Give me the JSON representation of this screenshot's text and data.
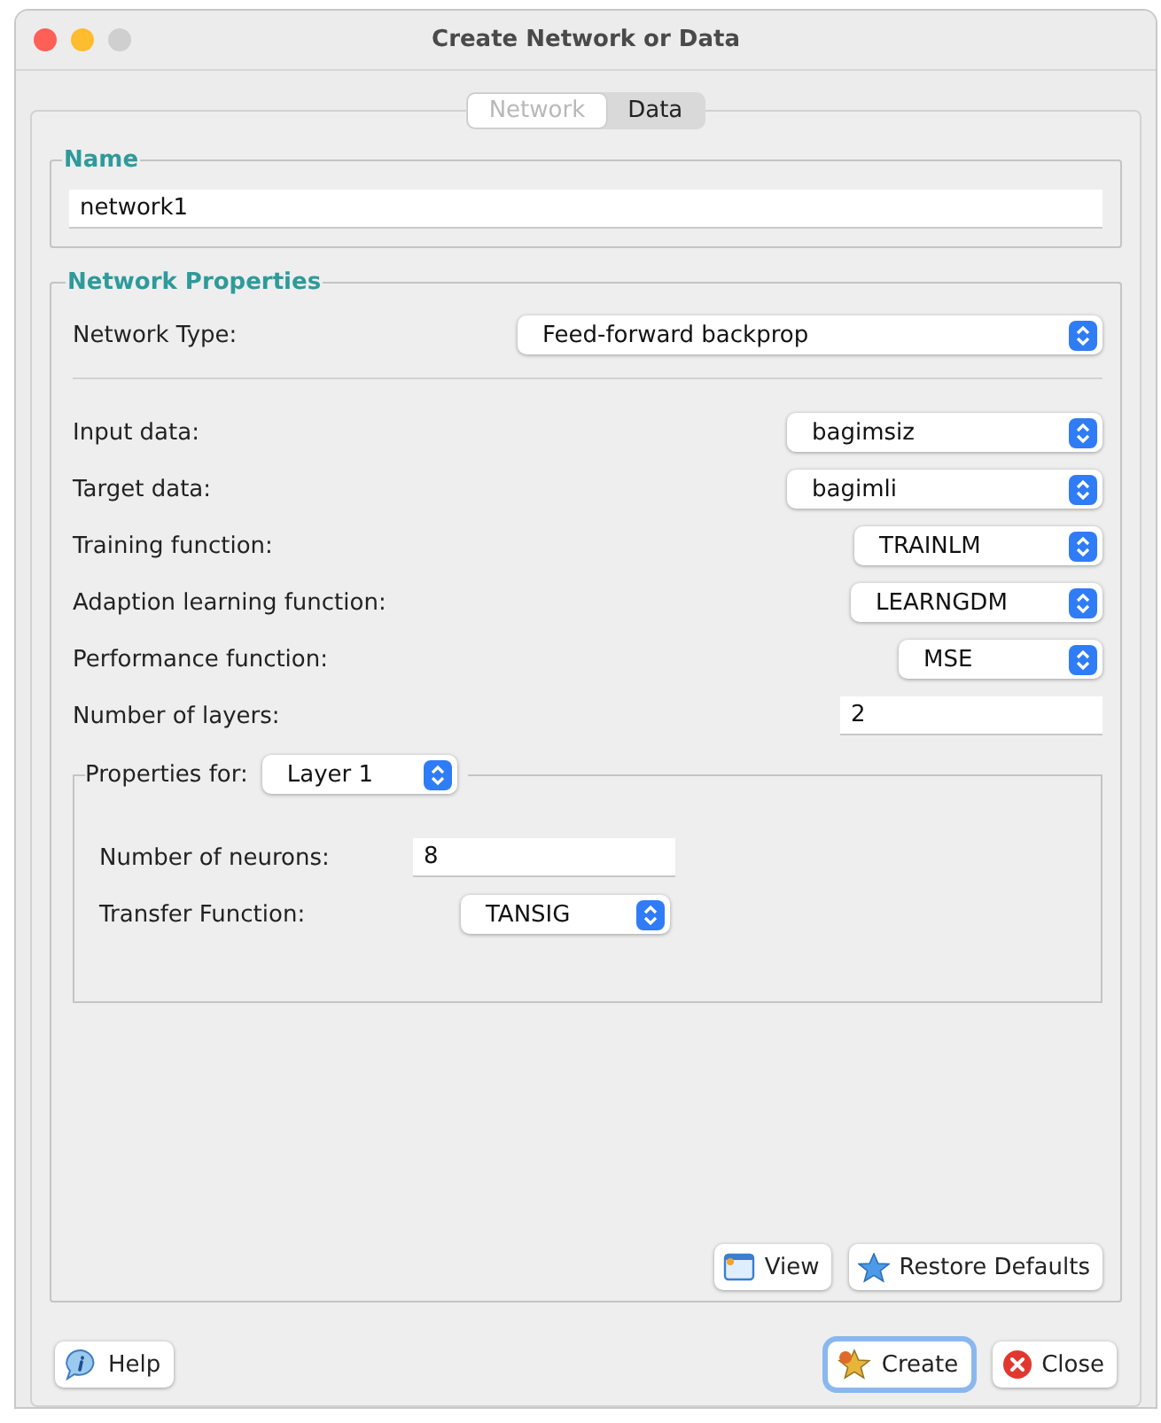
{
  "window": {
    "title": "Create Network or Data"
  },
  "tabs": [
    {
      "label": "Network",
      "selected": true
    },
    {
      "label": "Data",
      "selected": false
    }
  ],
  "name_group": {
    "title": "Name",
    "value": "network1"
  },
  "network_properties": {
    "title": "Network Properties",
    "network_type": {
      "label": "Network Type:",
      "value": "Feed-forward backprop"
    },
    "fields": [
      {
        "kind": "select",
        "label": "Input data:",
        "value": "bagimsiz"
      },
      {
        "kind": "select",
        "label": "Target data:",
        "value": "bagimli"
      },
      {
        "kind": "select",
        "label": "Training function:",
        "value": "TRAINLM"
      },
      {
        "kind": "select",
        "label": "Adaption learning function:",
        "value": "LEARNGDM"
      },
      {
        "kind": "select",
        "label": "Performance function:",
        "value": "MSE"
      },
      {
        "kind": "input",
        "label": "Number of layers:",
        "value": "2"
      }
    ],
    "layer_properties": {
      "label": "Properties for:",
      "layer": "Layer 1",
      "neurons": {
        "label": "Number of neurons:",
        "value": "8"
      },
      "transfer": {
        "label": "Transfer Function:",
        "value": "TANSIG"
      }
    },
    "buttons": [
      {
        "kind": "view",
        "label": "View"
      },
      {
        "kind": "restore",
        "label": "Restore Defaults"
      }
    ]
  },
  "footer_buttons": [
    {
      "kind": "help",
      "label": "Help",
      "focused": false
    },
    {
      "kind": "create",
      "label": "Create",
      "focused": true
    },
    {
      "kind": "close",
      "label": "Close",
      "focused": false
    }
  ]
}
